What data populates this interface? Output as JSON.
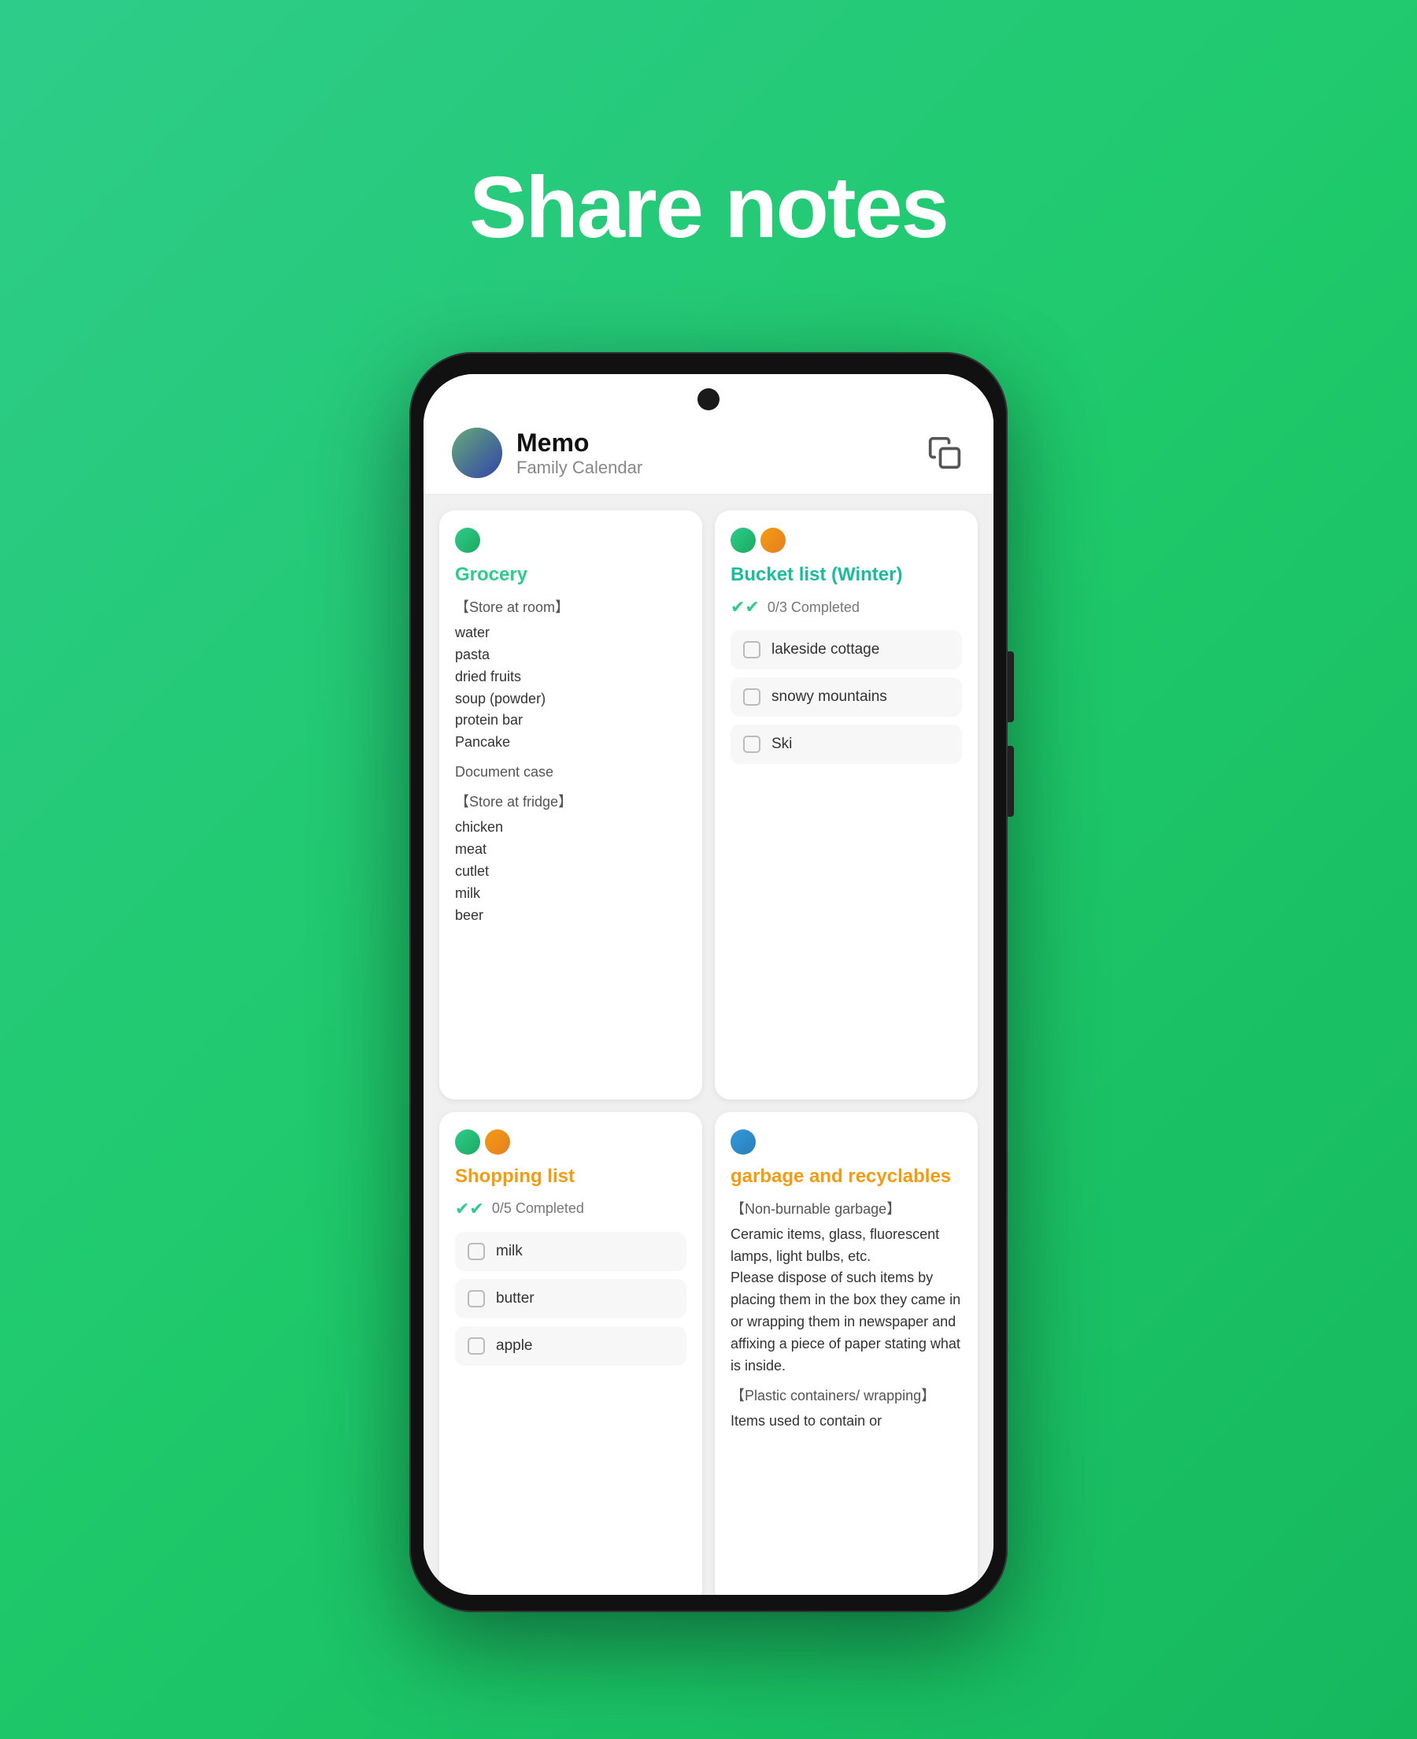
{
  "hero": {
    "title": "Share notes"
  },
  "header": {
    "app_name": "Memo",
    "subtitle": "Family Calendar",
    "copy_icon": "copy-icon"
  },
  "notes": [
    {
      "id": "grocery",
      "type": "text",
      "column": "left",
      "avatars": [
        "green"
      ],
      "title": "Grocery",
      "title_color": "green",
      "sections": [
        {
          "label": "【Store at room】",
          "items": [
            "water",
            "pasta",
            "dried fruits",
            "soup (powder)",
            "protein bar",
            "Pancake"
          ]
        },
        {
          "label": "Document case",
          "items": []
        },
        {
          "label": "【Store at fridge】",
          "items": [
            "chicken",
            "meat",
            "cutlet",
            "milk",
            "beer"
          ]
        }
      ]
    },
    {
      "id": "bucket-list-winter",
      "type": "checklist",
      "column": "right",
      "avatars": [
        "green",
        "orange"
      ],
      "title": "Bucket list (Winter)",
      "title_color": "teal",
      "completed_label": "0/3 Completed",
      "items": [
        {
          "label": "lakeside cottage",
          "checked": false
        },
        {
          "label": "snowy mountains",
          "checked": false
        },
        {
          "label": "Ski",
          "checked": false
        }
      ]
    },
    {
      "id": "shopping-list",
      "type": "checklist",
      "column": "left",
      "avatars": [
        "green",
        "orange"
      ],
      "title": "Shopping list",
      "title_color": "orange",
      "completed_label": "0/5 Completed",
      "items": [
        {
          "label": "milk",
          "checked": false
        },
        {
          "label": "butter",
          "checked": false
        },
        {
          "label": "apple",
          "checked": false
        }
      ]
    },
    {
      "id": "garbage-recyclables",
      "type": "text",
      "column": "right",
      "avatars": [
        "blue"
      ],
      "title": "garbage and recyclables",
      "title_color": "orange",
      "sections": [
        {
          "label": "【Non-burnable garbage】",
          "items": [
            "Ceramic items, glass, fluorescent lamps, light bulbs, etc.",
            "Please dispose of such items by placing them in the box they came in or wrapping them in newspaper and affixing a piece of paper stating what is inside."
          ]
        },
        {
          "label": "【Plastic containers/ wrapping】",
          "items": [
            "Items used to contain or"
          ]
        }
      ]
    }
  ]
}
